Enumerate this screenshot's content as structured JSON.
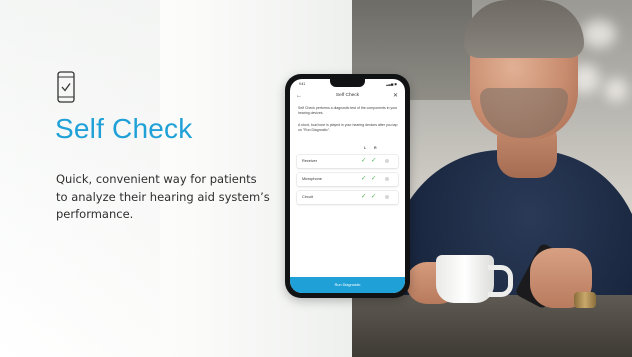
{
  "slide": {
    "title": "Self Check",
    "subtitle": "Quick, convenient way for patients to analyze their hearing aid system’s performance.",
    "icon": "phone-check-icon",
    "accent_color": "#1fa1d8"
  },
  "phone_app": {
    "status_time": "9:41",
    "status_icons": "▂▃▅ ◼",
    "nav": {
      "back_icon": "←",
      "title": "Self Check",
      "close_icon": "✕"
    },
    "description_1": "Self Check performs a diagnostic test of the components in your hearing devices.",
    "description_2": "A short, loud tone is played in your hearing devices after you tap on \"Run Diagnostic\".",
    "columns": [
      "L",
      "R"
    ],
    "rows": [
      {
        "label": "Receiver",
        "left": "✓",
        "right": "✓"
      },
      {
        "label": "Microphone",
        "left": "✓",
        "right": "✓"
      },
      {
        "label": "Circuit",
        "left": "✓",
        "right": "✓"
      }
    ],
    "button_label": "Run Diagnostic",
    "check_color": "#55b85a"
  }
}
